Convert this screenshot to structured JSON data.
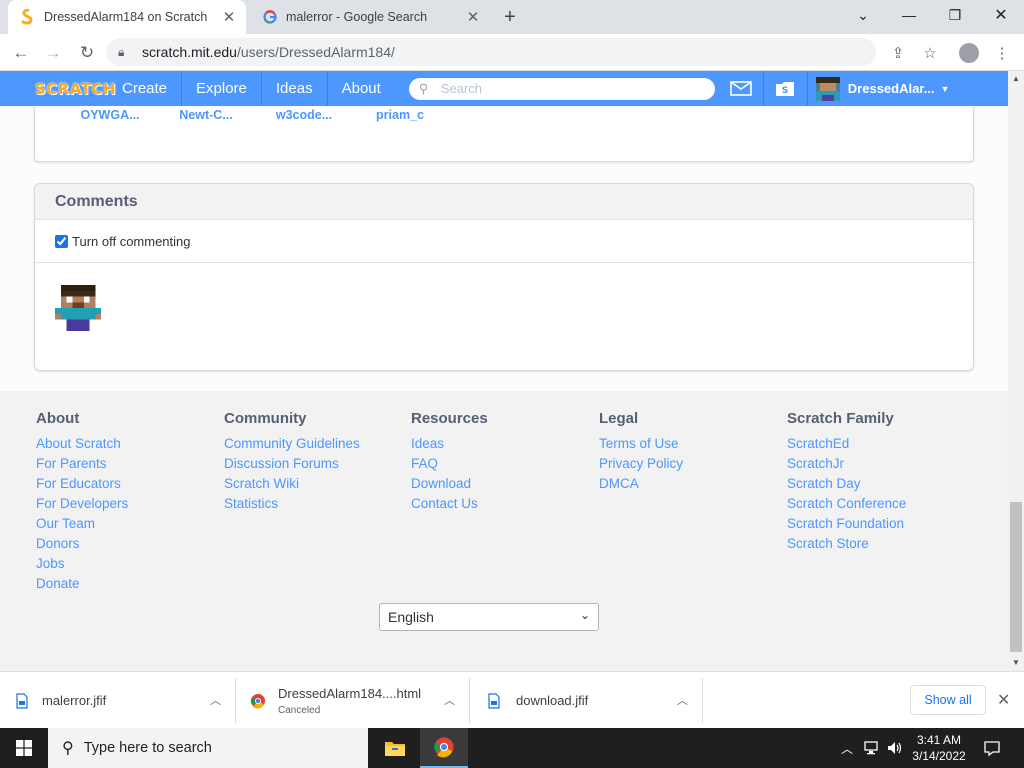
{
  "browser": {
    "tabs": [
      {
        "title": "DressedAlarm184 on Scratch",
        "active": true,
        "favicon": "scratch-favicon"
      },
      {
        "title": "malerror - Google Search",
        "active": false,
        "favicon": "google-favicon"
      }
    ],
    "url_host": "scratch.mit.edu",
    "url_path": "/users/DressedAlarm184/"
  },
  "scratch_nav": {
    "logo": "SCRATCH",
    "items": [
      "Create",
      "Explore",
      "Ideas",
      "About"
    ],
    "search_placeholder": "Search",
    "username": "DressedAlar..."
  },
  "following": {
    "items": [
      {
        "name": "OYWGA..."
      },
      {
        "name": "Newt-C..."
      },
      {
        "name": "w3code..."
      },
      {
        "name": "priam_c"
      }
    ]
  },
  "comments": {
    "title": "Comments",
    "toggle_label": "Turn off commenting",
    "toggle_checked": true
  },
  "footer": {
    "columns": [
      {
        "heading": "About",
        "links": [
          "About Scratch",
          "For Parents",
          "For Educators",
          "For Developers",
          "Our Team",
          "Donors",
          "Jobs",
          "Donate"
        ]
      },
      {
        "heading": "Community",
        "links": [
          "Community Guidelines",
          "Discussion Forums",
          "Scratch Wiki",
          "Statistics"
        ]
      },
      {
        "heading": "Resources",
        "links": [
          "Ideas",
          "FAQ",
          "Download",
          "Contact Us"
        ]
      },
      {
        "heading": "Legal",
        "links": [
          "Terms of Use",
          "Privacy Policy",
          "DMCA"
        ]
      },
      {
        "heading": "Scratch Family",
        "links": [
          "ScratchEd",
          "ScratchJr",
          "Scratch Day",
          "Scratch Conference",
          "Scratch Foundation",
          "Scratch Store"
        ]
      }
    ],
    "language": "English"
  },
  "downloads": {
    "items": [
      {
        "name": "malerror.jfif",
        "status": ""
      },
      {
        "name": "DressedAlarm184....html",
        "status": "Canceled"
      },
      {
        "name": "download.jfif",
        "status": ""
      }
    ],
    "show_all": "Show all"
  },
  "taskbar": {
    "search_placeholder": "Type here to search",
    "time": "3:41 AM",
    "date": "3/14/2022"
  },
  "colors": {
    "scratch_blue": "#4d97ff",
    "scratch_orange": "#ffab19",
    "footer_heading": "#575e75"
  }
}
